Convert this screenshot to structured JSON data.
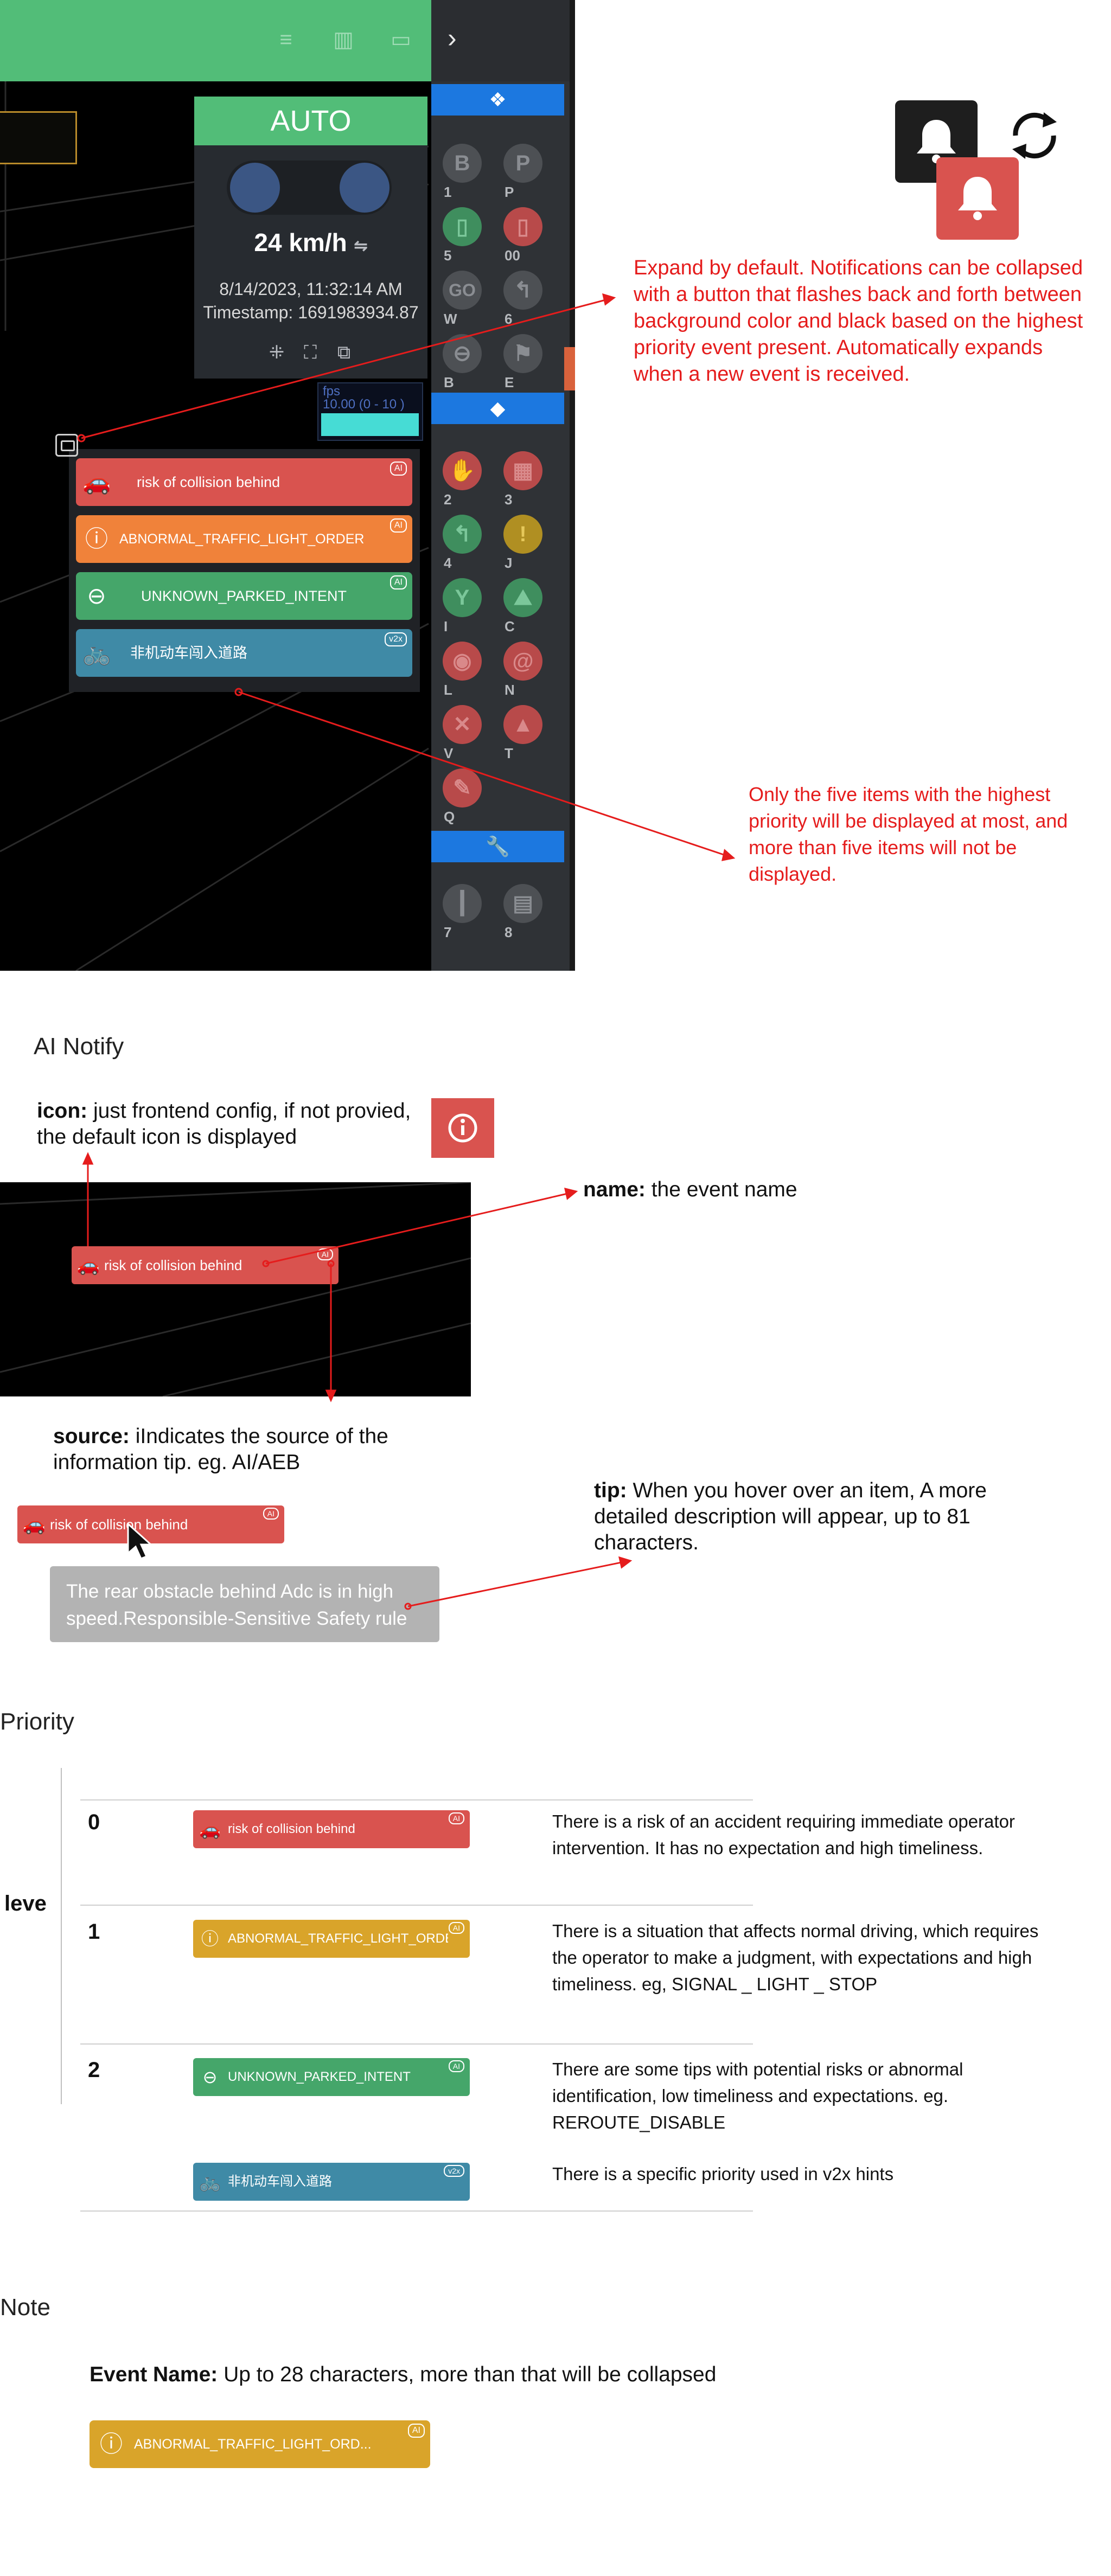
{
  "app": {
    "mode": "AUTO",
    "speed": "24 km/h",
    "speed_icon": "swap-icon",
    "date": "8/14/2023, 11:32:14 AM",
    "timestamp": "Timestamp: 1691983934.87",
    "fps_label": "fps",
    "fps_range": "10.00 (0 - 10 )",
    "notifications": [
      {
        "name": "risk of collision behind",
        "source": "AI",
        "color": "#d9534f",
        "icon": "car-collision-icon"
      },
      {
        "name": "ABNORMAL_TRAFFIC_LIGHT_ORDER",
        "source": "AI",
        "color": "#f0823a",
        "icon": "traffic-light-icon"
      },
      {
        "name": "UNKNOWN_PARKED_INTENT",
        "source": "AI",
        "color": "#45a66a",
        "icon": "no-entry-icon"
      },
      {
        "name": "非机动车闯入道路",
        "source": "v2x",
        "color": "#3f8aa6",
        "icon": "bicycle-road-icon"
      }
    ],
    "sidebar": {
      "group1": [
        {
          "glyph": "B",
          "label": "1",
          "style": "gray"
        },
        {
          "glyph": "P",
          "label": "P",
          "style": "gray"
        },
        {
          "glyph": "▯",
          "label": "5",
          "style": "green"
        },
        {
          "glyph": "▯",
          "label": "00",
          "style": "red"
        },
        {
          "glyph": "GO",
          "label": "W",
          "style": "gray"
        },
        {
          "glyph": "↰",
          "label": "6",
          "style": "gray"
        },
        {
          "glyph": "⊖",
          "label": "B",
          "style": "gray"
        },
        {
          "glyph": "⚑",
          "label": "E",
          "style": "gray"
        }
      ],
      "group2": [
        {
          "glyph": "✋",
          "label": "2",
          "style": "red"
        },
        {
          "glyph": "▦",
          "label": "3",
          "style": "red"
        },
        {
          "glyph": "↰",
          "label": "4",
          "style": "green"
        },
        {
          "glyph": "!",
          "label": "J",
          "style": "yel"
        },
        {
          "glyph": "Y",
          "label": "I",
          "style": "green"
        },
        {
          "glyph": "⛰",
          "label": "C",
          "style": "green"
        },
        {
          "glyph": "◉",
          "label": "L",
          "style": "red"
        },
        {
          "glyph": "@",
          "label": "N",
          "style": "red"
        },
        {
          "glyph": "✕",
          "label": "V",
          "style": "red"
        },
        {
          "glyph": "▲",
          "label": "T",
          "style": "red"
        },
        {
          "glyph": "✎",
          "label": "Q",
          "style": "red"
        }
      ],
      "group3": [
        {
          "glyph": "┃",
          "label": "7",
          "style": "gray"
        },
        {
          "glyph": "▤",
          "label": "8",
          "style": "gray"
        }
      ]
    }
  },
  "annotations": {
    "expand": "Expand by default. Notifications can be collapsed with a button that flashes back and forth between background color and black based on the highest priority event present. Automatically expands when a new event is received.",
    "five_items": "Only the five items with the highest priority will be displayed at most, and more than five items will not be displayed."
  },
  "ai_notify": {
    "title": "AI Notify",
    "icon_label": "icon:",
    "icon_desc": "just frontend config, if not provied, the default icon is displayed",
    "name_label": "name:",
    "name_desc": "the event name",
    "source_label": "source:",
    "source_desc": "iIndicates the source of the information tip. eg. AI/AEB",
    "tip_label": "tip:",
    "tip_desc": "When you hover over an item, A more detailed description will appear, up to 81 characters.",
    "example_name": "risk of collision behind",
    "example_source": "AI",
    "tip_text_1": "The rear obstacle behind Adc is in high",
    "tip_text_2": "speed.Responsible-Sensitive Safety rule"
  },
  "priority": {
    "title": "Priority",
    "axis_label": "leve",
    "rows": [
      {
        "level": "0",
        "name": "risk of collision behind",
        "source": "AI",
        "color": "#d9534f",
        "icon": "car-collision-icon",
        "desc": "There is a risk of an accident requiring immediate operator intervention. It has no expectation and high timeliness."
      },
      {
        "level": "1",
        "name": "ABNORMAL_TRAFFIC_LIGHT_ORDER",
        "source": "AI",
        "color": "#d9a42a",
        "icon": "traffic-light-icon",
        "desc": "There is a situation that affects normal driving, which requires the operator to make a judgment, with expectations and high timeliness. eg, SIGNAL _ LIGHT _ STOP"
      },
      {
        "level": "2",
        "name": "UNKNOWN_PARKED_INTENT",
        "source": "AI",
        "color": "#45a66a",
        "icon": "no-entry-icon",
        "desc": "There are some tips with potential risks or abnormal identification, low timeliness and expectations. eg. REROUTE_DISABLE"
      },
      {
        "level": "",
        "name": "非机动车闯入道路",
        "source": "v2x",
        "color": "#3f8aa6",
        "icon": "bicycle-road-icon",
        "desc": "There is a specific priority used in v2x hints"
      }
    ]
  },
  "note": {
    "title": "Note",
    "label": "Event Name:",
    "desc": "Up to 28 characters, more than that will be collapsed",
    "example": "ABNORMAL_TRAFFIC_LIGHT_ORD...",
    "example_source": "AI",
    "example_color": "#d9a42a"
  }
}
